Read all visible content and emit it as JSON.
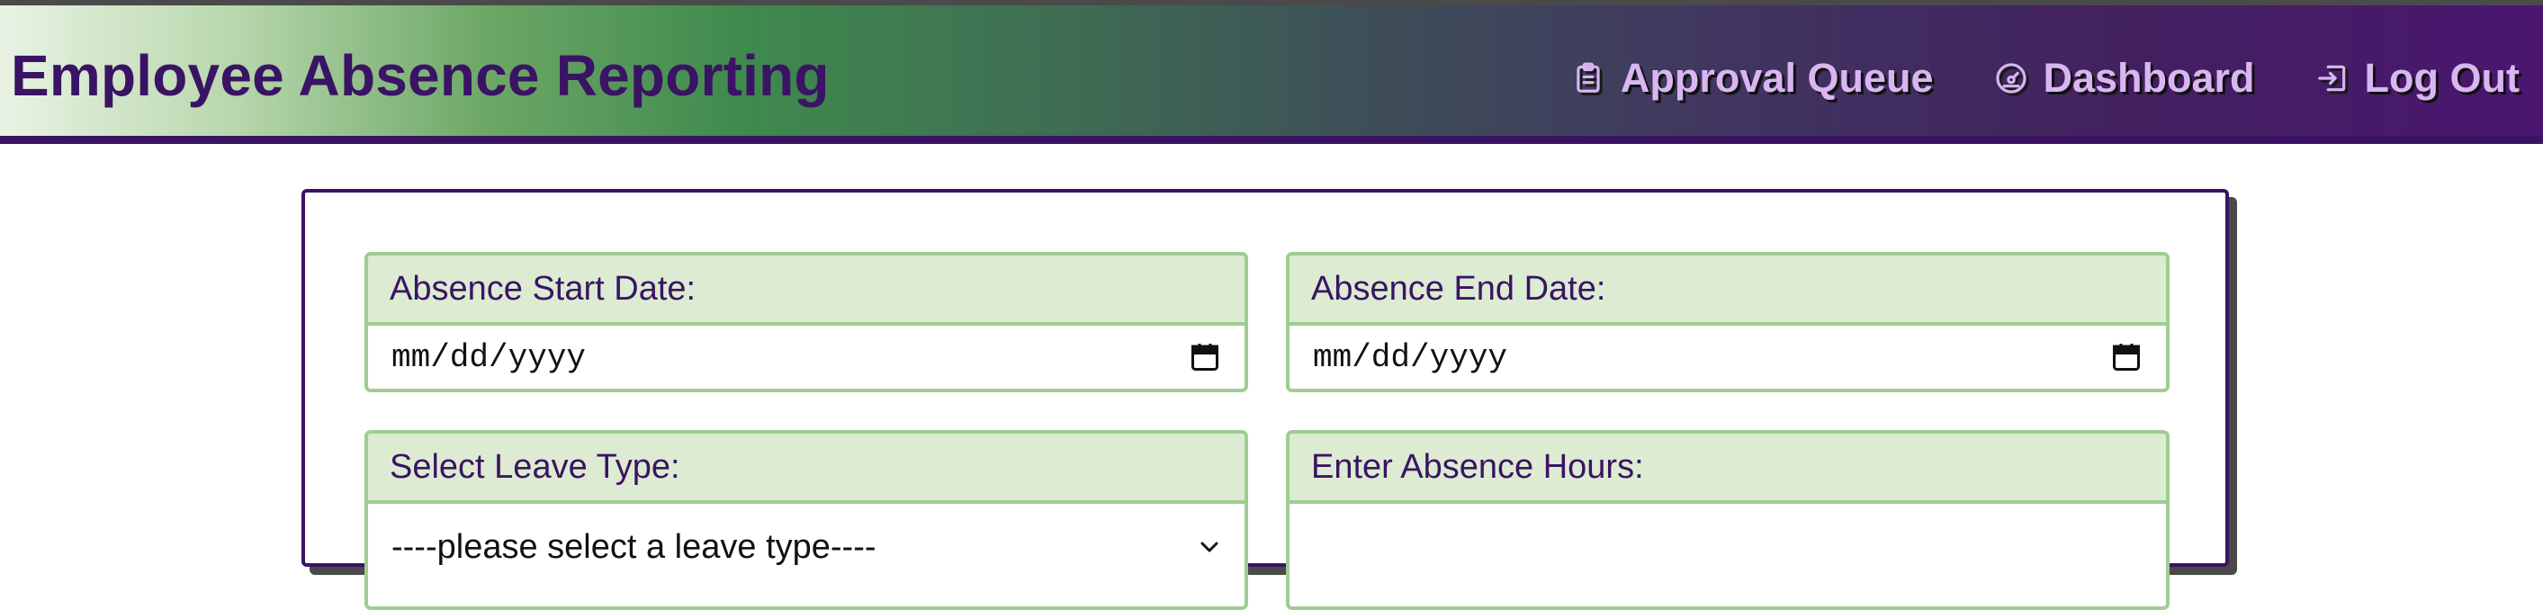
{
  "header": {
    "title": "Employee Absence Reporting",
    "nav": [
      {
        "label": "Approval Queue",
        "icon": "clipboard-icon"
      },
      {
        "label": "Dashboard",
        "icon": "dashboard-gauge-icon"
      },
      {
        "label": "Log Out",
        "icon": "log-out-icon"
      }
    ]
  },
  "form": {
    "start_date": {
      "label": "Absence Start Date:",
      "placeholder": "mm/dd/yyyy",
      "icon": "calendar-icon"
    },
    "end_date": {
      "label": "Absence End Date:",
      "placeholder": "mm/dd/yyyy",
      "icon": "calendar-icon"
    },
    "leave_type": {
      "label": "Select Leave Type:",
      "selected": "----please select a leave type----",
      "icon": "chevron-down-icon"
    },
    "absence_hours": {
      "label": "Enter Absence Hours:",
      "value": ""
    }
  },
  "colors": {
    "brand_purple": "#3a1463",
    "nav_text": "#d9b6f2",
    "field_border": "#9fcd92",
    "field_label_bg": "#dcebd2"
  }
}
